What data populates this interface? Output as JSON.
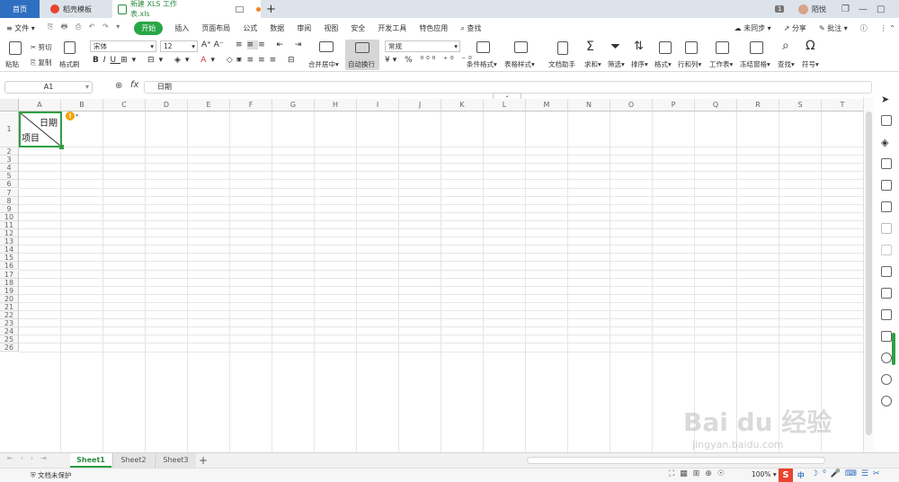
{
  "tabs": {
    "home": "首页",
    "template": "稻壳模板",
    "file": "新建 XLS 工作表.xls",
    "add": "+"
  },
  "user": {
    "badge": "1",
    "name": "陌悦"
  },
  "menu": {
    "file": "文件",
    "items": [
      "开始",
      "插入",
      "页面布局",
      "公式",
      "数据",
      "审阅",
      "视图",
      "安全",
      "开发工具",
      "特色应用"
    ],
    "search": "查找",
    "sync": "未同步",
    "share": "分享",
    "comment": "批注"
  },
  "ribbon": {
    "paste": "粘贴",
    "cut": "剪切",
    "copy": "复制",
    "format_painter": "格式刷",
    "font_name": "宋体",
    "font_size": "12",
    "merge_center": "合并居中",
    "wrap_text": "自动换行",
    "number_format": "常规",
    "conditional_format": "条件格式",
    "table_style": "表格样式",
    "doc_helper": "文档助手",
    "sum": "求和",
    "filter": "筛选",
    "sort": "排序",
    "format": "格式",
    "row_col": "行和列",
    "worksheet": "工作表",
    "freeze": "冻结窗格",
    "find": "查找",
    "symbol": "符号"
  },
  "formula": {
    "cell_ref": "A1",
    "fx": "fx",
    "value": "日期"
  },
  "grid": {
    "columns": [
      "A",
      "B",
      "C",
      "D",
      "E",
      "F",
      "G",
      "H",
      "I",
      "J",
      "K",
      "L",
      "M",
      "N",
      "O",
      "P",
      "Q",
      "R",
      "S",
      "T"
    ],
    "rows": [
      "1",
      "2",
      "3",
      "4",
      "5",
      "6",
      "7",
      "8",
      "9",
      "10",
      "11",
      "12",
      "13",
      "14",
      "15",
      "16",
      "17",
      "18",
      "19",
      "20",
      "21",
      "22",
      "23",
      "24",
      "25",
      "26"
    ],
    "cell_a1_top": "日期",
    "cell_a1_bottom": "项目"
  },
  "sheets": [
    "Sheet1",
    "Sheet2",
    "Sheet3"
  ],
  "status": {
    "protect": "文档未保护",
    "zoom": "100%",
    "ime": "中"
  },
  "watermark": {
    "brand": "Bai du 经验",
    "url": "jingyan.baidu.com"
  },
  "colors": {
    "accent_green": "#27a745",
    "tab_blue": "#2f6fc1",
    "grid_line": "#e6e6e6"
  }
}
